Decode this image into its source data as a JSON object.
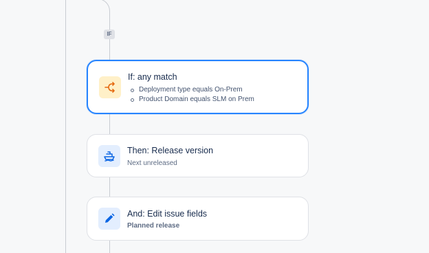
{
  "flow": {
    "branch_badge": "IF",
    "condition": {
      "title": "If: any match",
      "icon": "branch-icon",
      "items": [
        "Deployment type equals On-Prem",
        "Product Domain equals SLM on Prem"
      ]
    },
    "action_release": {
      "title": "Then: Release version",
      "subtitle": "Next unreleased",
      "icon": "ship-icon"
    },
    "action_edit": {
      "title": "And: Edit issue fields",
      "subtitle": "Planned release",
      "icon": "pencil-icon"
    }
  },
  "colors": {
    "selected_border": "#2684ff",
    "condition_icon": "#e56910",
    "action_icon": "#0c66e4"
  }
}
